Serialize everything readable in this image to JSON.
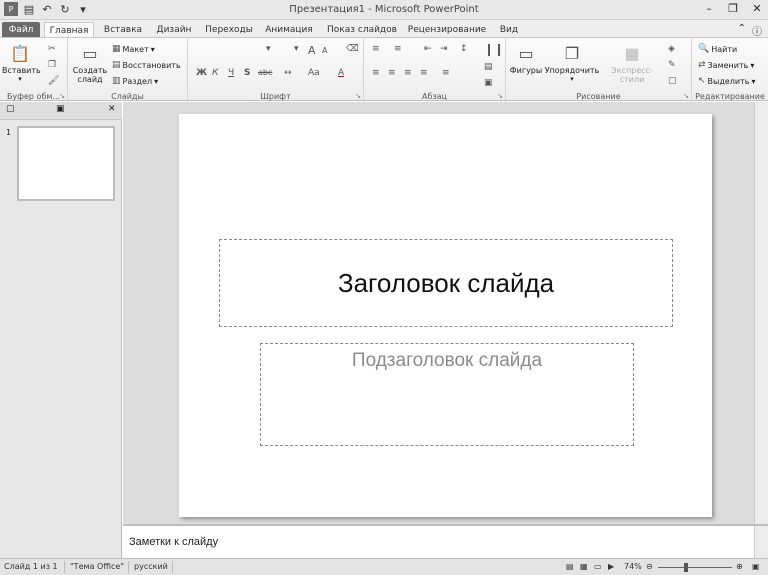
{
  "window": {
    "title": "Презентация1 - Microsoft PowerPoint",
    "qat_icons": [
      "powerpoint-icon",
      "save-icon",
      "undo-icon",
      "redo-icon",
      "customize-qat-icon"
    ],
    "controls": [
      "minimize-icon",
      "restore-icon",
      "close-icon"
    ]
  },
  "tabs": [
    "Файл",
    "Главная",
    "Вставка",
    "Дизайн",
    "Переходы",
    "Анимация",
    "Показ слайдов",
    "Рецензирование",
    "Вид"
  ],
  "active_tab": "Главная",
  "ribbon": {
    "clipboard": {
      "label": "Буфер обм...",
      "paste": "Вставить"
    },
    "slides": {
      "label": "Слайды",
      "new_slide_line1": "Создать",
      "new_slide_line2": "слайд",
      "layout": "Макет",
      "reset": "Восстановить",
      "section": "Раздел"
    },
    "font": {
      "label": "Шрифт",
      "bold": "Ж",
      "italic": "К",
      "underline": "Ч",
      "strike": "S",
      "abc": "abc",
      "grow": "A",
      "shrink": "A",
      "case": "Aa",
      "color": "A"
    },
    "paragraph": {
      "label": "Абзац"
    },
    "drawing": {
      "label": "Рисование",
      "shapes": "Фигуры",
      "arrange": "Упорядочить",
      "quick_styles": "Экспресс-стили"
    },
    "editing": {
      "label": "Редактирование",
      "find": "Найти",
      "replace": "Заменить",
      "select": "Выделить"
    }
  },
  "slide_panel": {
    "thumb_number": "1"
  },
  "slide": {
    "title": "Заголовок слайда",
    "subtitle": "Подзаголовок слайда"
  },
  "notes": {
    "placeholder": "Заметки к слайду"
  },
  "status": {
    "slide_counter": "Слайд 1 из 1",
    "theme": "\"Тема Office\"",
    "language": "русский",
    "zoom": "74%",
    "zoom_level_percent": 74
  }
}
